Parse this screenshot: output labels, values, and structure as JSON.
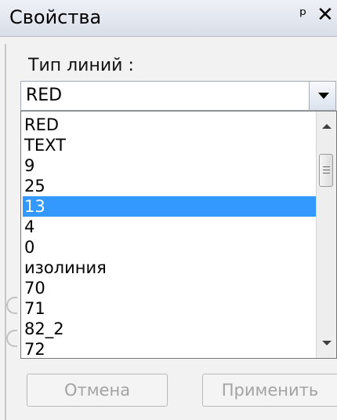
{
  "window": {
    "title": "Свойства",
    "pin_glyph": "ᵖ",
    "close_glyph": "✕"
  },
  "line_type": {
    "label": "Тип линий :",
    "selected_value": "RED",
    "options": [
      "RED",
      "TEXT",
      "9",
      "25",
      "13",
      "4",
      "0",
      "изолиния",
      "70",
      "71",
      "82_2",
      "72"
    ],
    "highlighted_option": "13"
  },
  "buttons": {
    "cancel": "Отмена",
    "apply": "Применить"
  },
  "colors": {
    "selection": "#3399ff",
    "disabled_text": "#a3a3a3"
  },
  "icons": [
    "pin-icon",
    "close-icon",
    "dropdown-arrow-icon",
    "scroll-up-icon",
    "scroll-down-icon"
  ]
}
